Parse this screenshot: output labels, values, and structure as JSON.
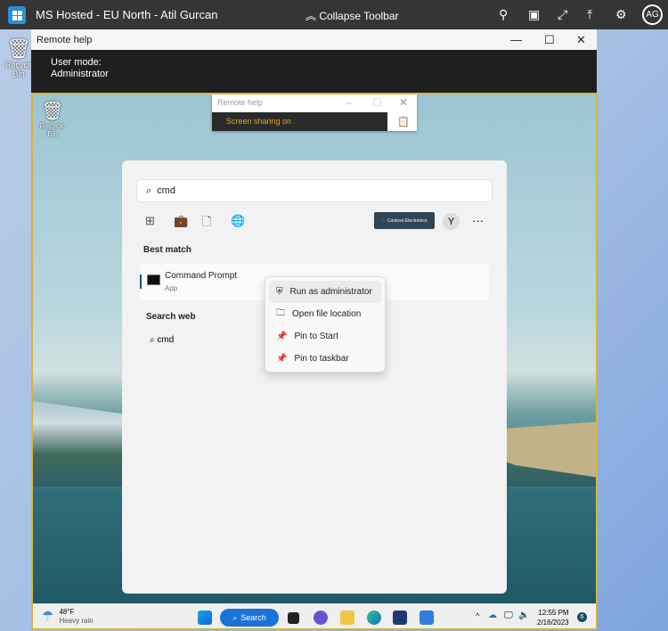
{
  "toolbar": {
    "title": "MS Hosted - EU North - Atil Gurcan",
    "collapse_label": "Collapse Toolbar",
    "avatar": "AG"
  },
  "outer_desktop": {
    "recycle_label": "Recycle Bin"
  },
  "remote_help": {
    "title": "Remote help",
    "user_mode_label": "User mode:",
    "user_mode_value": "Administrator"
  },
  "inner": {
    "recycle_label": "Recycle Bin",
    "mini_title": "Remote help",
    "sharing_status": "Screen sharing on"
  },
  "start": {
    "search_value": "cmd",
    "org_label": "Contoso Electronics",
    "user_initial": "Y",
    "best_match_heading": "Best match",
    "result_name": "Command Prompt",
    "result_sub": "App",
    "search_web_heading": "Search web",
    "web_query": "cmd"
  },
  "context_menu": [
    {
      "label": "Run as administrator",
      "icon": "admin-shield-icon"
    },
    {
      "label": "Open file location",
      "icon": "folder-icon"
    },
    {
      "label": "Pin to Start",
      "icon": "pin-icon"
    },
    {
      "label": "Pin to taskbar",
      "icon": "pin-icon"
    }
  ],
  "taskbar": {
    "temp": "48°F",
    "weather": "Heavy rain",
    "search_label": "Search",
    "time": "12:55 PM",
    "date": "2/16/2023",
    "notif_count": "6"
  },
  "colors": {
    "frame_border": "#d7b43a",
    "accent": "#1a73d9",
    "sharing": "#e6a323"
  }
}
